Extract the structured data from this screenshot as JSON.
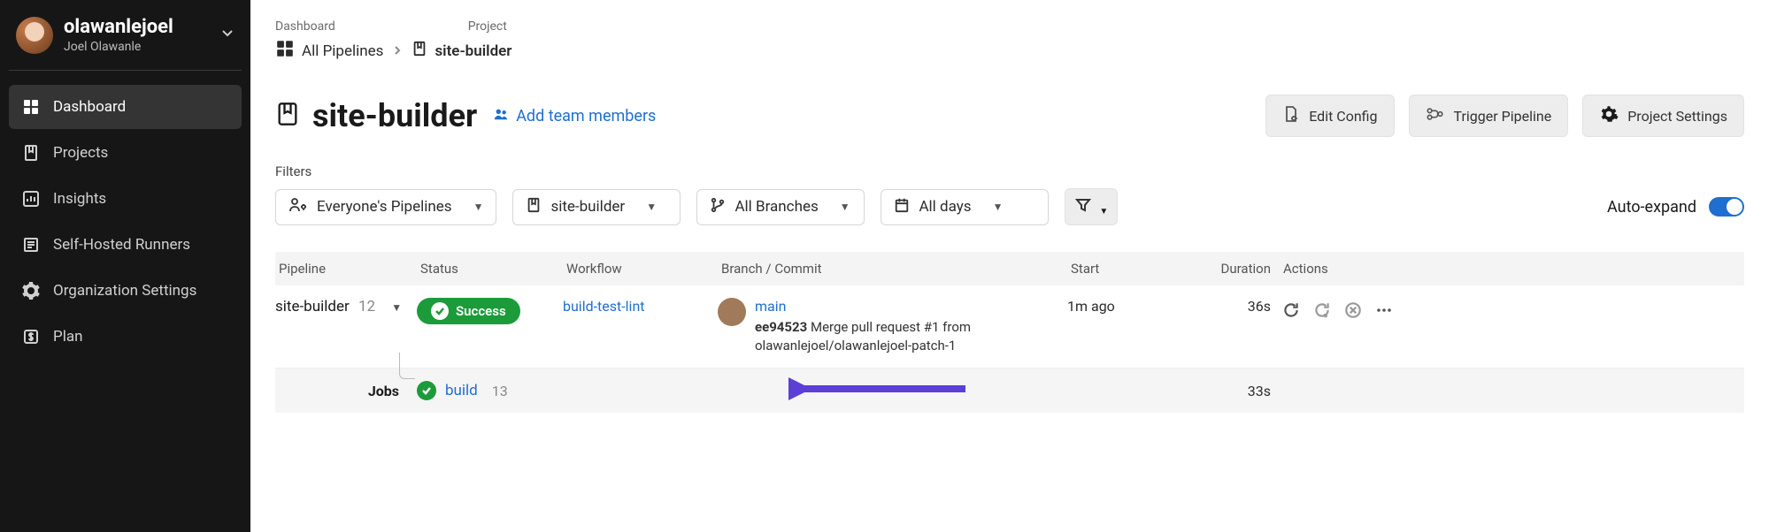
{
  "user": {
    "handle": "olawanlejoel",
    "full": "Joel Olawanle"
  },
  "nav": {
    "dashboard": "Dashboard",
    "projects": "Projects",
    "insights": "Insights",
    "runners": "Self-Hosted Runners",
    "org": "Organization Settings",
    "plan": "Plan"
  },
  "crumbs": {
    "dashboard_label": "Dashboard",
    "project_label": "Project",
    "all_pipelines": "All Pipelines",
    "project_name": "site-builder"
  },
  "project": {
    "title": "site-builder",
    "add_team": "Add team members"
  },
  "actions": {
    "edit_config": "Edit Config",
    "trigger": "Trigger Pipeline",
    "settings": "Project Settings"
  },
  "filters": {
    "label": "Filters",
    "pipelines": "Everyone's Pipelines",
    "project": "site-builder",
    "branches": "All Branches",
    "days": "All days",
    "auto_expand": "Auto-expand"
  },
  "table": {
    "cols": {
      "pipeline": "Pipeline",
      "status": "Status",
      "workflow": "Workflow",
      "branch": "Branch / Commit",
      "start": "Start",
      "duration": "Duration",
      "actions": "Actions"
    },
    "row1": {
      "name": "site-builder",
      "num": "12",
      "status": "Success",
      "workflow": "build-test-lint",
      "branch": "main",
      "sha": "ee94523",
      "msg": "Merge pull request #1 from olawanlejoel/olawanlejoel-patch-1",
      "start": "1m ago",
      "duration": "36s"
    },
    "jobs": {
      "label": "Jobs",
      "name": "build",
      "num": "13",
      "duration": "33s"
    }
  }
}
